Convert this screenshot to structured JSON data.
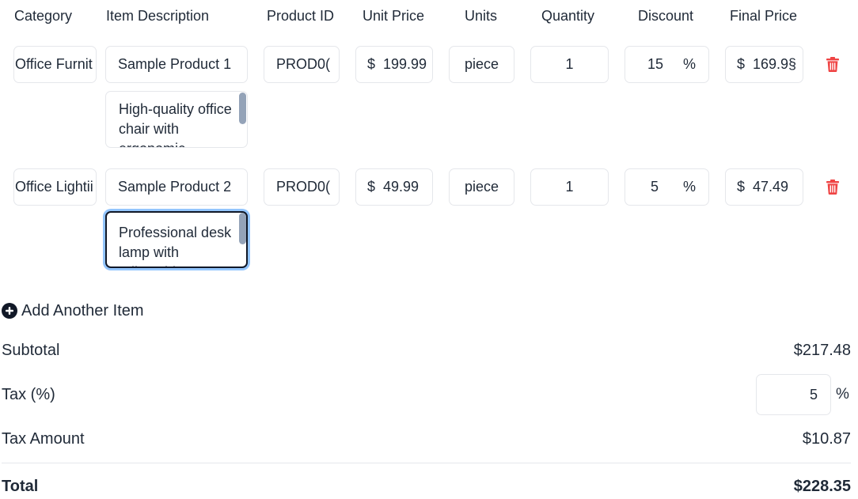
{
  "headers": {
    "category": "Category",
    "item_description": "Item Description",
    "product_id": "Product ID",
    "unit_price": "Unit Price",
    "units": "Units",
    "quantity": "Quantity",
    "discount": "Discount",
    "final_price": "Final Price"
  },
  "items": [
    {
      "category": "Office Furnit",
      "name": "Sample Product 1",
      "description": "High-quality office chair with ergonomic",
      "product_id": "PROD0(",
      "currency": "$",
      "unit_price": "199.99",
      "units": "piece",
      "quantity": "1",
      "discount": "15",
      "discount_unit": "%",
      "final_price": "169.9§"
    },
    {
      "category": "Office Lightii",
      "name": "Sample Product 2",
      "description": "Professional desk lamp with adjustable",
      "product_id": "PROD0(",
      "currency": "$",
      "unit_price": "49.99",
      "units": "piece",
      "quantity": "1",
      "discount": "5",
      "discount_unit": "%",
      "final_price": "47.49"
    }
  ],
  "add_item_label": "Add Another Item",
  "summary": {
    "subtotal_label": "Subtotal",
    "subtotal_value": "$217.48",
    "tax_label": "Tax (%)",
    "tax_value": "5",
    "tax_unit": "%",
    "tax_amount_label": "Tax Amount",
    "tax_amount_value": "$10.87",
    "total_label": "Total",
    "total_value": "$228.35"
  },
  "colors": {
    "delete_icon": "#ef4444",
    "focus_ring": "#93c5fd",
    "scrollbar_thumb": "#94a3b8",
    "border": "#e5e7eb"
  },
  "icons": {
    "delete": "trash-icon",
    "add": "plus-circle-icon"
  }
}
